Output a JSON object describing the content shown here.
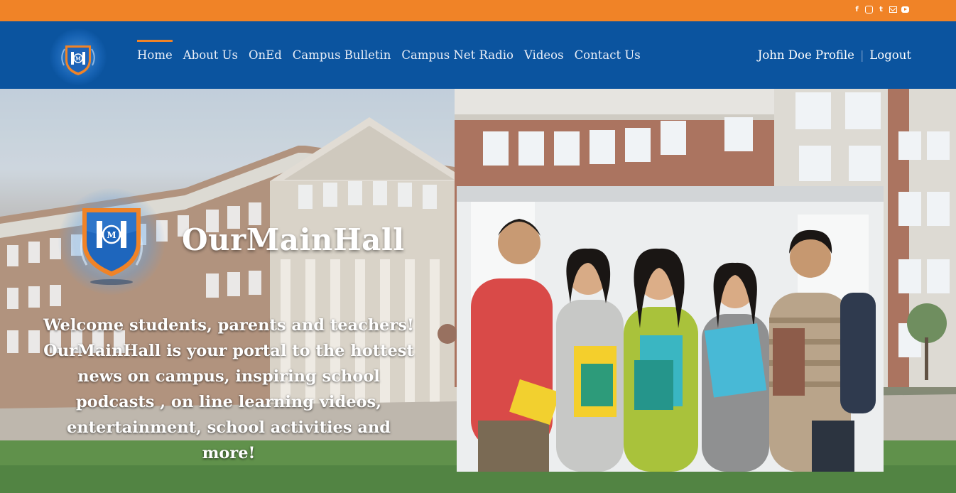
{
  "topbar": {
    "social": [
      "facebook-icon",
      "instagram-icon",
      "twitter-icon",
      "mail-icon",
      "youtube-icon"
    ],
    "social_glyphs": {
      "facebook": "f",
      "twitter": "t"
    },
    "color": "#f08327"
  },
  "navbar": {
    "color": "#0b549f",
    "items": [
      {
        "label": "Home",
        "active": true
      },
      {
        "label": "About Us"
      },
      {
        "label": "OnEd"
      },
      {
        "label": "Campus Bulletin"
      },
      {
        "label": "Campus Net Radio"
      },
      {
        "label": "Videos"
      },
      {
        "label": "Contact Us"
      }
    ],
    "user": {
      "profile_label": "John Doe Profile",
      "separator": "|",
      "logout_label": "Logout"
    }
  },
  "logo": {
    "letters": "HM",
    "center_letter": "M"
  },
  "hero": {
    "brand": "OurMainHall",
    "welcome": "Welcome students, parents and teachers! OurMainHall is your portal to the hottest news on campus, inspiring school podcasts , on line learning videos, entertainment, school activities and more!"
  },
  "colors": {
    "accent": "#f08327",
    "brand_blue": "#0b549f",
    "shield_blue": "#1d63b8"
  }
}
